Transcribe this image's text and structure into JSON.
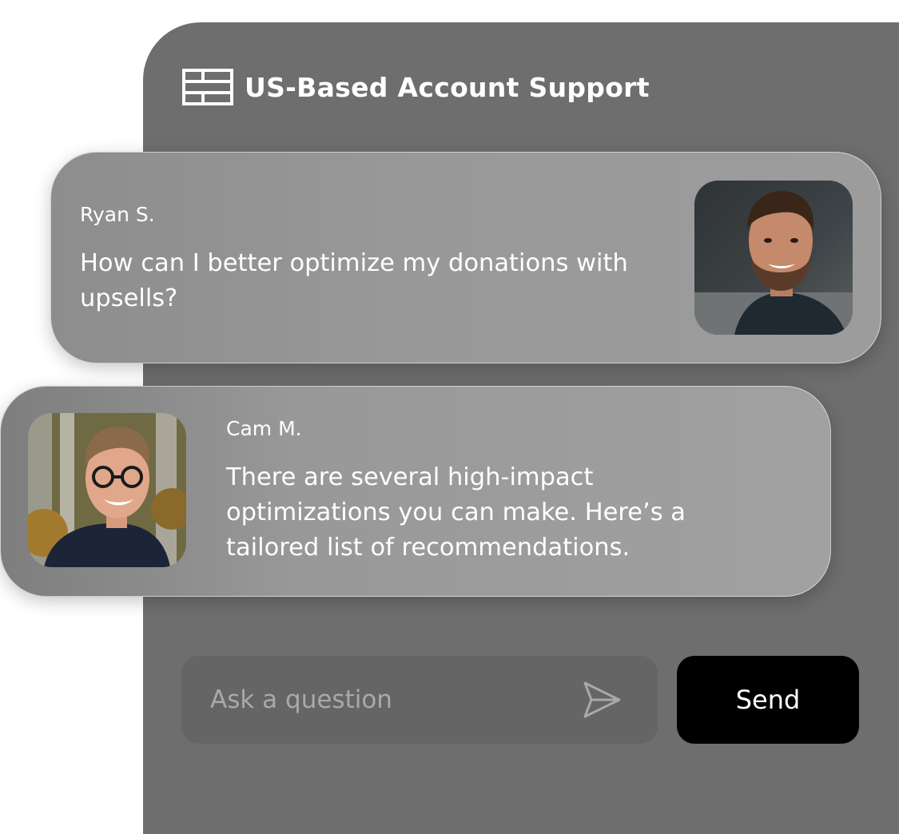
{
  "header": {
    "title": "US-Based Account Support",
    "icon": "dashboard-layout-icon"
  },
  "messages": [
    {
      "sender": "Ryan S.",
      "text": "How can I better optimize my donations with upsells?",
      "avatar": "ryan-avatar-photo"
    },
    {
      "sender": "Cam M.",
      "text": "There are several high-impact optimizations you can make. Here’s a tailored list of recommendations.",
      "avatar": "cam-avatar-photo"
    }
  ],
  "composer": {
    "placeholder": "Ask a question",
    "value": "",
    "send_icon": "paper-plane-icon",
    "send_label": "Send"
  },
  "colors": {
    "panel": "#6e6e6e",
    "input": "#656565",
    "send_button": "#000000",
    "text": "#ffffff",
    "placeholder": "#a9a9a9"
  }
}
